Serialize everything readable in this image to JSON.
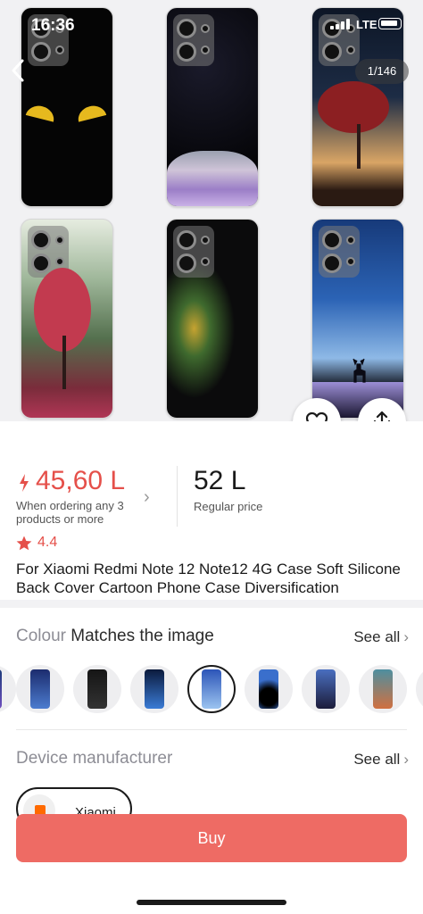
{
  "status_bar": {
    "time": "16:36",
    "network": "LTE"
  },
  "gallery": {
    "counter": "1/146"
  },
  "price": {
    "sale": "45,60 L",
    "condition": "When ordering any 3 products or more",
    "regular": "52 L",
    "regular_label": "Regular price"
  },
  "rating": {
    "value": "4.4"
  },
  "product": {
    "title": "For Xiaomi Redmi Note 12 Note12 4G Case Soft Silicone Back Cover Cartoon Phone Case Diversification"
  },
  "colour": {
    "label": "Colour",
    "value": "Matches the image",
    "see_all": "See all"
  },
  "manufacturer": {
    "label": "Device manufacturer",
    "see_all": "See all",
    "chip": "Xiaomi"
  },
  "buy_label": "Buy",
  "colors": {
    "accent": "#E5504A",
    "buy": "#EE6B64"
  }
}
